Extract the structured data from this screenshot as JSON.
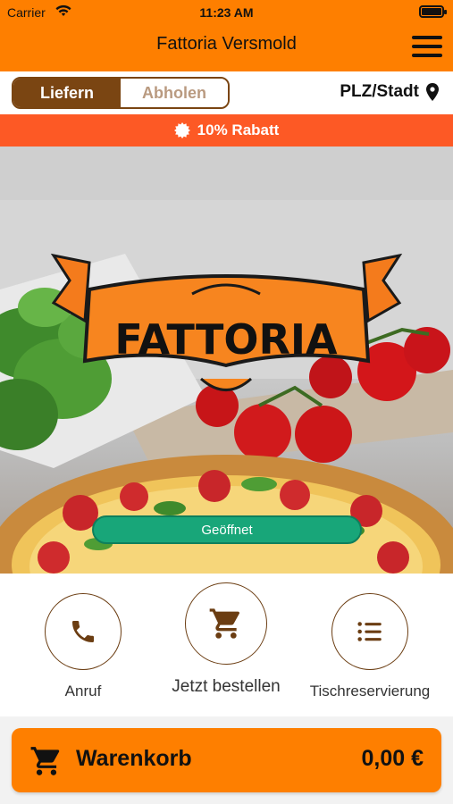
{
  "status_bar": {
    "carrier": "Carrier",
    "time": "11:23 AM"
  },
  "header": {
    "title": "Fattoria Versmold",
    "menu_icon": "hamburger-menu-icon"
  },
  "delivery_toggle": {
    "options": [
      "Liefern",
      "Abholen"
    ],
    "selected": "Liefern"
  },
  "location": {
    "label": "PLZ/Stadt",
    "icon": "location-pin-icon"
  },
  "discount_banner": {
    "text": "10% Rabatt",
    "icon": "badge-icon"
  },
  "hero": {
    "logo_text": "FATTORIA",
    "status_button": "Geöffnet"
  },
  "actions": [
    {
      "label": "Anruf",
      "icon": "phone-icon"
    },
    {
      "label": "Jetzt bestellen",
      "icon": "cart-icon"
    },
    {
      "label": "Tischreservierung",
      "icon": "list-icon"
    }
  ],
  "cart": {
    "label": "Warenkorb",
    "total": "0,00 €",
    "icon": "cart-icon"
  },
  "colors": {
    "orange": "#fe7f00",
    "banner": "#fd5925",
    "brown": "#7a4512",
    "open_green": "#18a679"
  }
}
